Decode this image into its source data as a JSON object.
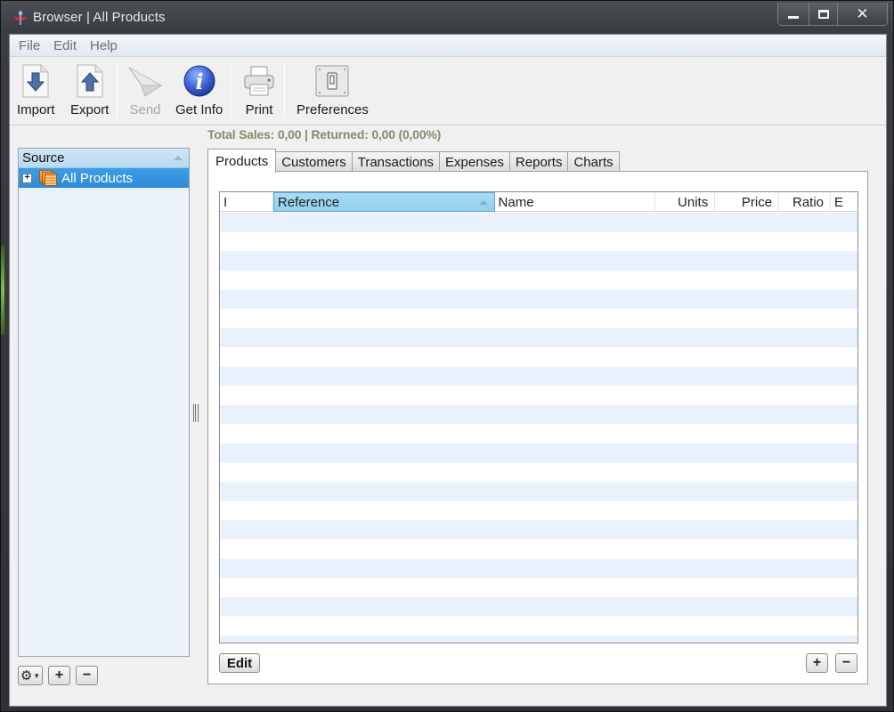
{
  "window": {
    "title": "Browser | All Products",
    "controls": {
      "minimize": "minimize",
      "maximize": "maximize",
      "close": "✕"
    }
  },
  "menu": [
    "File",
    "Edit",
    "Help"
  ],
  "toolbar": {
    "items": [
      {
        "label": "Import",
        "icon": "import-icon",
        "enabled": true
      },
      {
        "label": "Export",
        "icon": "export-icon",
        "enabled": true
      },
      {
        "label": "Send",
        "icon": "send-icon",
        "enabled": false
      },
      {
        "label": "Get Info",
        "icon": "info-icon",
        "enabled": true
      },
      {
        "label": "Print",
        "icon": "printer-icon",
        "enabled": true
      },
      {
        "label": "Preferences",
        "icon": "preferences-switch-icon",
        "enabled": true
      }
    ]
  },
  "sidebar": {
    "header": "Source",
    "items": [
      {
        "label": "All Products",
        "selected": true,
        "expander": "+"
      }
    ],
    "footer": {
      "gear": "⚙",
      "add": "+",
      "remove": "−"
    }
  },
  "summary": "Total Sales: 0,00 | Returned: 0,00 (0,00%)",
  "tabs": [
    {
      "label": "Products",
      "active": true
    },
    {
      "label": "Customers",
      "active": false
    },
    {
      "label": "Transactions",
      "active": false
    },
    {
      "label": "Expenses",
      "active": false
    },
    {
      "label": "Reports",
      "active": false
    },
    {
      "label": "Charts",
      "active": false
    }
  ],
  "table": {
    "columns": [
      {
        "label": "I"
      },
      {
        "label": "Reference",
        "sorted": "ascending"
      },
      {
        "label": "Name"
      },
      {
        "label": "Units"
      },
      {
        "label": "Price"
      },
      {
        "label": "Ratio"
      },
      {
        "label": "E"
      }
    ],
    "rows": []
  },
  "panel_buttons": {
    "edit": "Edit",
    "add": "+",
    "remove": "−"
  },
  "colors": {
    "selection": "#3c9de6",
    "sorted_header": "#a7dcf4",
    "row_alt": "#e9f1fc",
    "summary_text": "#8a8a6e"
  }
}
